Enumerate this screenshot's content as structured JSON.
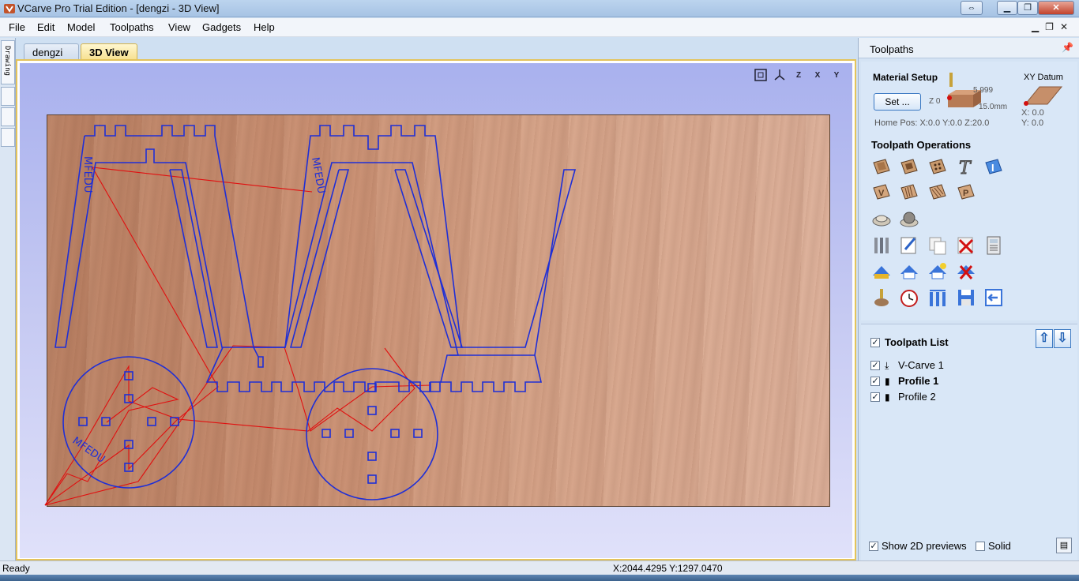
{
  "window": {
    "title": "VCarve Pro Trial Edition - [dengzi - 3D View]"
  },
  "menu": {
    "items": [
      "File",
      "Edit",
      "Model",
      "Toolpaths",
      "View",
      "Gadgets",
      "Help"
    ]
  },
  "left_strip": {
    "drawing_tab": "Drawing"
  },
  "tabs": [
    {
      "label": "dengzi",
      "active": false
    },
    {
      "label": "3D View",
      "active": true
    }
  ],
  "view": {
    "toolbar_icons": [
      "zoom-extents-icon",
      "iso-view-icon",
      "z-view-icon",
      "x-view-icon",
      "y-view-icon"
    ],
    "toolbar_labels": {
      "z": "Z",
      "x": "X",
      "y": "Y"
    },
    "engraved_text": [
      "MFEDU",
      "MFEDU",
      "MFEDU"
    ],
    "colors": {
      "vector": "#1f2fd6",
      "toolpath": "#e01010",
      "wood": "#c98f72"
    }
  },
  "toolpaths_panel": {
    "title": "Toolpaths",
    "material_setup": {
      "label": "Material Setup",
      "set_button": "Set ...",
      "z_zero": "Z 0",
      "thickness_top": "5.999",
      "thickness": "15.0mm",
      "home_pos": "Home Pos:  X:0.0 Y:0.0 Z:20.0",
      "xy_datum_label": "XY Datum",
      "datum_x": "X: 0.0",
      "datum_y": "Y: 0.0"
    },
    "operations_label": "Toolpath Operations",
    "operation_icons": [
      "profile-toolpath-icon",
      "pocket-toolpath-icon",
      "drilling-toolpath-icon",
      "quick-engrave-icon",
      "inlay-toolpath-icon",
      "vcarve-toolpath-icon",
      "fluting-toolpath-icon",
      "texture-toolpath-icon",
      "prism-toolpath-icon",
      "3d-roughing-icon",
      "3d-finishing-icon",
      "tool-database-icon",
      "edit-toolpath-icon",
      "duplicate-toolpath-icon",
      "delete-toolpath-icon",
      "calculator-icon",
      "preview-all-icon",
      "preview-selected-icon",
      "reset-preview-icon",
      "preview-toolpath-icon",
      "material-preview-icon",
      "time-estimate-icon",
      "toolpath-summary-icon",
      "save-toolpath-icon",
      "close-panel-icon"
    ],
    "toolpath_list": {
      "label": "Toolpath List",
      "items": [
        {
          "name": "V-Carve 1",
          "checked": true,
          "bold": false,
          "icon": "vcarve-tool-icon"
        },
        {
          "name": "Profile 1",
          "checked": true,
          "bold": true,
          "icon": "endmill-tool-icon"
        },
        {
          "name": "Profile 2",
          "checked": true,
          "bold": false,
          "icon": "endmill-tool-icon"
        }
      ]
    },
    "show_2d_previews": {
      "label": "Show 2D previews",
      "checked": true
    },
    "solid": {
      "label": "Solid",
      "checked": false
    }
  },
  "status": {
    "text": "Ready",
    "coords": "X:2044.4295 Y:1297.0470"
  }
}
